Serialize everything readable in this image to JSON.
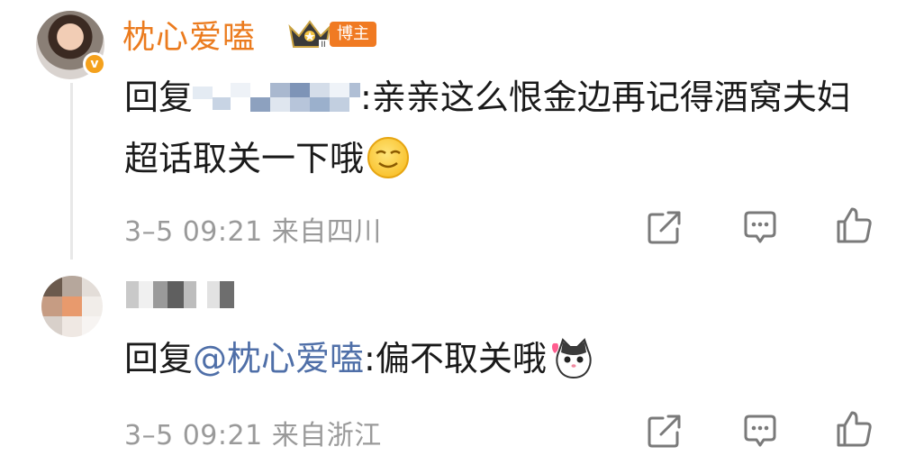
{
  "comments": [
    {
      "username": "枕心爱嗑",
      "badge_label": "博主",
      "vip_mark": "v",
      "reply_prefix": "回复",
      "text": ":亲亲这么恨金边再记得酒窝夫妇超话取关一下哦",
      "meta": "3–5 09:21 来自四川"
    },
    {
      "reply_prefix": "回复",
      "mention": "@枕心爱嗑",
      "text": ":偏不取关哦",
      "meta": "3–5 09:21 来自浙江"
    }
  ],
  "icons": {
    "share": "share-icon",
    "comment": "comment-icon",
    "like": "thumbs-up-icon",
    "smile_emoji": "smirk-emoji-icon",
    "cat_emoji": "cat-love-emoji-icon"
  },
  "colors": {
    "username": "#eb7b1e",
    "mention": "#4f6fa8",
    "meta": "#9a9a9a",
    "badge": "#f07a22"
  }
}
